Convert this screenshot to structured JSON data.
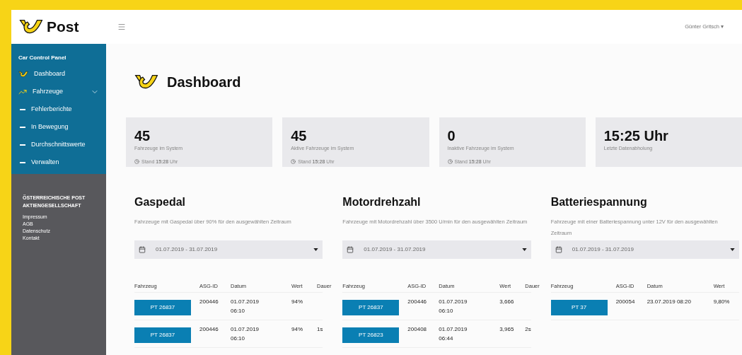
{
  "header": {
    "brand": "Post",
    "user": "Günter Gritsch ▾"
  },
  "sidebar": {
    "title": "Car Control Panel",
    "items": [
      {
        "label": "Dashboard",
        "kind": "logo"
      },
      {
        "label": "Fahrzeuge",
        "kind": "chart",
        "expanded": true,
        "children": [
          {
            "label": "Fehlerberichte",
            "kind": "sub"
          },
          {
            "label": "In Bewegung",
            "kind": "sub"
          },
          {
            "label": "Durchschnittswerte",
            "kind": "sub"
          },
          {
            "label": "Verwalten",
            "kind": "sub"
          }
        ]
      }
    ],
    "footer": {
      "company": "ÖSTERREICHISCHE POST AKTIENGESELLSCHAFT",
      "links": [
        "Impressum",
        "AGB",
        "Datenschutz",
        "Kontakt"
      ]
    }
  },
  "page_title": "Dashboard",
  "stats": [
    {
      "value": "45",
      "label": "Fahrzeuge im System",
      "stand": "Stand **15:28** Uhr"
    },
    {
      "value": "45",
      "label": "Aktive Fahrzeuge im System",
      "stand": "Stand **15:28** Uhr"
    },
    {
      "value": "0",
      "label": "Inaktive Fahrzeuge im System",
      "stand": "Stand **15:28** Uhr"
    },
    {
      "value": "15:25 Uhr",
      "label": "Letzte Datenabholung"
    }
  ],
  "sections": [
    {
      "title": "Gaspedal",
      "description": "Fahrzeuge mit Gaspedal über 90% für den ausgewählten Zeitraum",
      "date_range": "01.07.2019 - 31.07.2019",
      "columns": [
        "Fahrzeug",
        "ASG-ID",
        "Datum",
        "Wert",
        "Dauer"
      ],
      "rows": [
        {
          "vehicle": "PT 26837",
          "asg_id": "200446",
          "date": "01.07.2019 06:10",
          "value": "94%"
        },
        {
          "vehicle": "PT 26837",
          "asg_id": "200446",
          "date": "01.07.2019 06:10",
          "value": "94%",
          "duration": "1s"
        }
      ]
    },
    {
      "title": "Motordrehzahl",
      "description": "Fahrzeuge mit Motordrehzahl über 3500 U/min für den ausgewählten Zeitraum",
      "date_range": "01.07.2019 - 31.07.2019",
      "columns": [
        "Fahrzeug",
        "ASG-ID",
        "Datum",
        "Wert",
        "Dauer"
      ],
      "rows": [
        {
          "vehicle": "PT 26837",
          "asg_id": "200446",
          "date": "01.07.2019 06:10",
          "value": "3,666"
        },
        {
          "vehicle": "PT 26823",
          "asg_id": "200408",
          "date": "01.07.2019 06:44",
          "value": "3,965",
          "duration": "2s"
        }
      ]
    },
    {
      "title": "Batteriespannung",
      "description": "Fahrzeuge mit einer Batteriespannung unter 12V für den ausgewählten Zeitraum",
      "date_range": "01.07.2019 - 31.07.2019",
      "columns": [
        "Fahrzeug",
        "ASG-ID",
        "Datum",
        "Wert"
      ],
      "rows": [
        {
          "vehicle": "PT 37",
          "asg_id": "200054",
          "date": "23.07.2019 08:20",
          "value": "9,80%"
        }
      ]
    }
  ]
}
